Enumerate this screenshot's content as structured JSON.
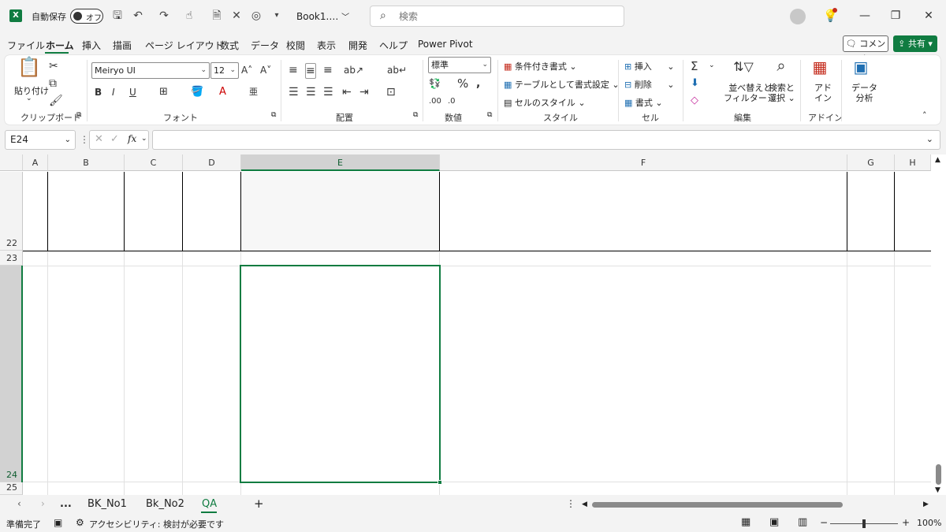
{
  "titlebar": {
    "autosave_label": "自動保存",
    "autosave_state": "オフ",
    "book_title": "Book1.…",
    "search_placeholder": "検索"
  },
  "menu": {
    "items": [
      "ファイル",
      "ホーム",
      "挿入",
      "描画",
      "ページ レイアウト",
      "数式",
      "データ",
      "校閲",
      "表示",
      "開発",
      "ヘルプ",
      "Power Pivot"
    ],
    "active": "ホーム",
    "comment_button": "コメント",
    "share_button": "共有"
  },
  "ribbon": {
    "clipboard": {
      "paste": "貼り付け",
      "label": "クリップボード"
    },
    "font": {
      "name": "Meiryo UI",
      "size": "12",
      "label": "フォント"
    },
    "alignment": {
      "label": "配置"
    },
    "number": {
      "format": "標準",
      "label": "数値"
    },
    "styles": {
      "conditional": "条件付き書式",
      "table": "テーブルとして書式設定",
      "cell_style": "セルのスタイル",
      "label": "スタイル"
    },
    "cells": {
      "insert": "挿入",
      "delete": "削除",
      "format": "書式",
      "label": "セル"
    },
    "editing": {
      "sort_line1": "並べ替えと",
      "sort_line2": "フィルター",
      "find_line1": "検索と",
      "find_line2": "選択",
      "label": "編集"
    },
    "addins": {
      "line1": "アド",
      "line2": "イン",
      "label": "アドイン"
    },
    "analysis": {
      "line1": "データ",
      "line2": "分析"
    }
  },
  "formula_bar": {
    "name_box": "E24",
    "fx": "fx",
    "formula": ""
  },
  "grid": {
    "columns": [
      "A",
      "B",
      "C",
      "D",
      "E",
      "F",
      "G",
      "H"
    ],
    "selected_column": "E",
    "rows": [
      "22",
      "23",
      "24",
      "25"
    ],
    "selected_row": "24"
  },
  "sheets": {
    "tabs": [
      "BK_No1",
      "Bk_No2",
      "QA"
    ],
    "active": "QA",
    "more": "...",
    "add": "+"
  },
  "status": {
    "ready": "準備完了",
    "accessibility": "アクセシビリティ: 検討が必要です",
    "zoom": "100%",
    "zoom_minus": "−",
    "zoom_plus": "+"
  },
  "colors": {
    "accent": "#107c41"
  }
}
